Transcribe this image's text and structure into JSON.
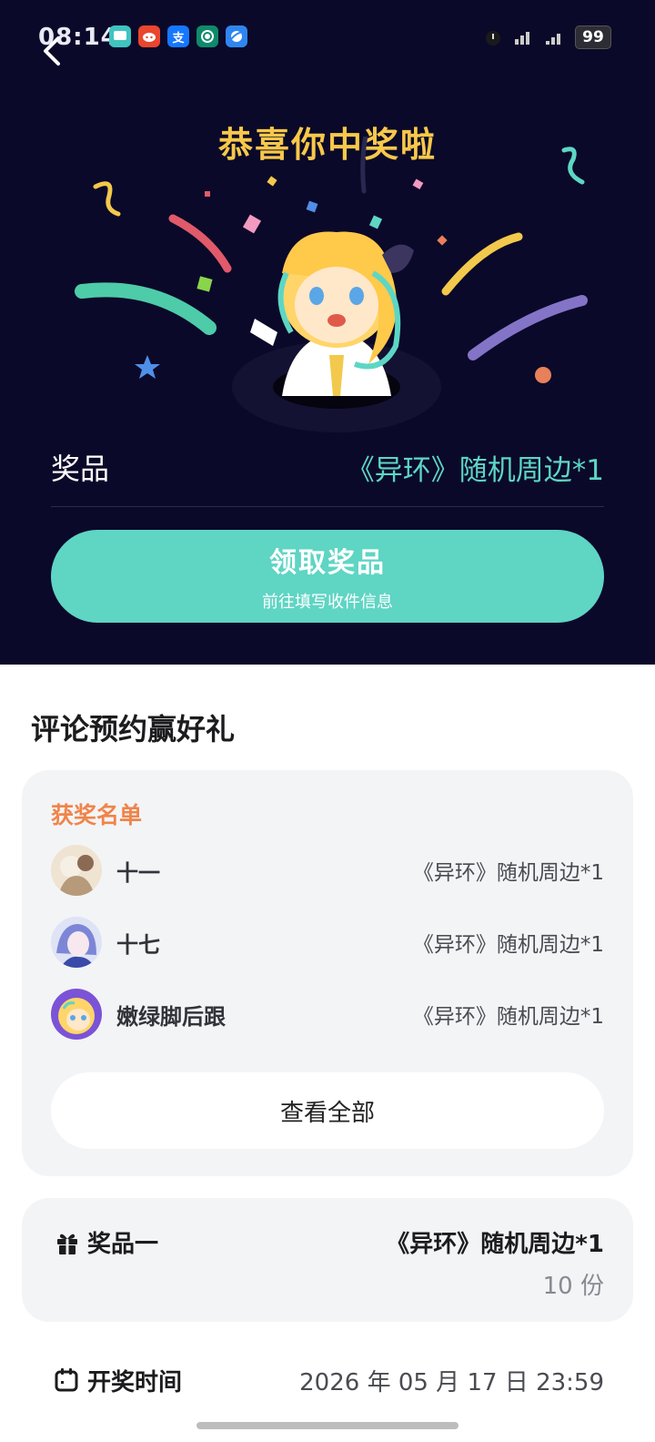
{
  "status_bar": {
    "time": "08:14",
    "battery": "99",
    "apps": [
      {
        "icon": "message-app-icon",
        "color": "#3fc4c0",
        "glyph": ""
      },
      {
        "icon": "reddit-app-icon",
        "color": "#e9462e",
        "glyph": ""
      },
      {
        "icon": "alipay-app-icon",
        "color": "#1677ff",
        "glyph": "支"
      },
      {
        "icon": "bank-app-icon",
        "color": "#0f8a6a",
        "glyph": ""
      },
      {
        "icon": "browser-app-icon",
        "color": "#2f86f0",
        "glyph": ""
      }
    ]
  },
  "header": {
    "congrats": "恭喜你中奖啦"
  },
  "prize_info": {
    "label": "奖品",
    "value": "《异环》随机周边*1"
  },
  "claim_button": {
    "title": "领取奖品",
    "subtitle": "前往填写收件信息"
  },
  "section": {
    "title": "评论预约赢好礼"
  },
  "winners": {
    "label": "获奖名单",
    "items": [
      {
        "name": "十一",
        "prize": "《异环》随机周边*1"
      },
      {
        "name": "十七",
        "prize": "《异环》随机周边*1"
      },
      {
        "name": "嫩绿脚后跟",
        "prize": "《异环》随机周边*1"
      }
    ],
    "view_all": "查看全部"
  },
  "prize_card": {
    "label": "奖品一",
    "name": "《异环》随机周边*1",
    "count": "10 份"
  },
  "draw": {
    "label": "开奖时间",
    "time": "2026 年 05 月 17 日 23:59"
  },
  "colors": {
    "header_bg": "#0b0929",
    "accent_teal": "#5fd5c4",
    "congrats_gold": "#f7c84a",
    "winner_label": "#f0844a"
  }
}
